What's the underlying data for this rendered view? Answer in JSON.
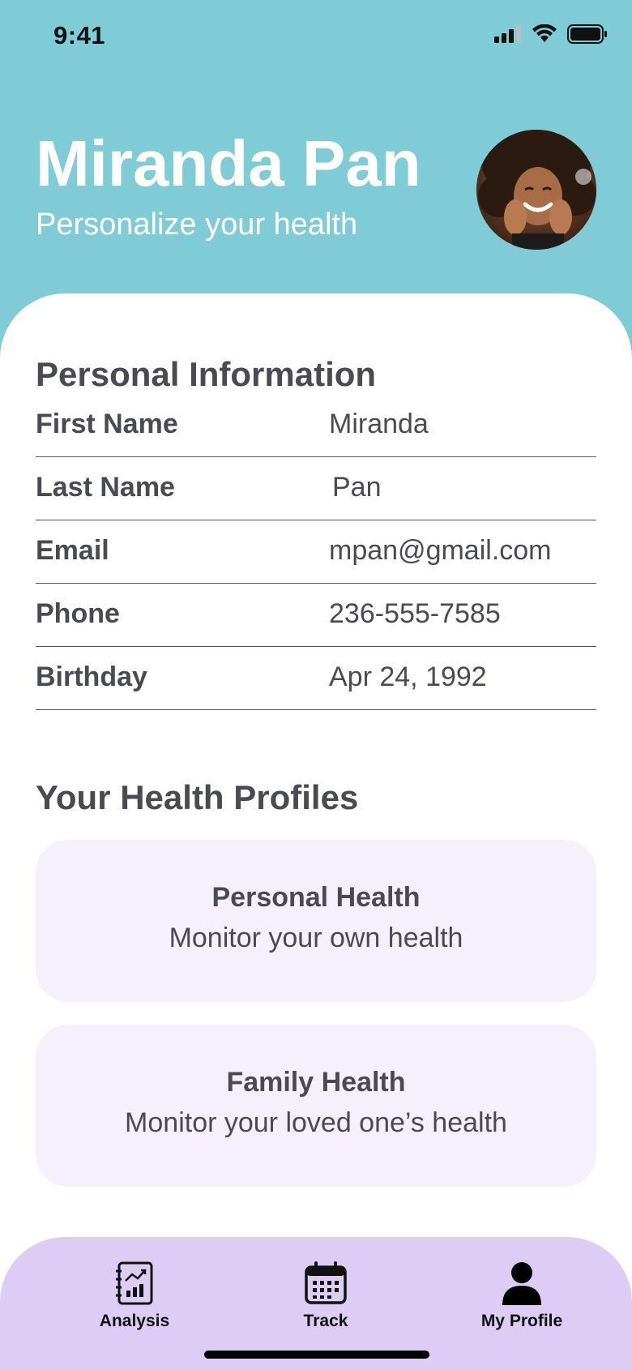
{
  "status": {
    "time": "9:41"
  },
  "header": {
    "name": "Miranda Pan",
    "subtitle": "Personalize your health"
  },
  "personal_info": {
    "title": "Personal Information",
    "rows": [
      {
        "label": "First Name",
        "value": "Miranda"
      },
      {
        "label": "Last Name",
        "value": "Pan"
      },
      {
        "label": "Email",
        "value": "mpan@gmail.com"
      },
      {
        "label": "Phone",
        "value": "236-555-7585"
      },
      {
        "label": "Birthday",
        "value": "Apr 24, 1992"
      }
    ]
  },
  "health_profiles": {
    "title": "Your Health Profiles",
    "cards": [
      {
        "title": "Personal Health",
        "subtitle": "Monitor your own health"
      },
      {
        "title": "Family Health",
        "subtitle": "Monitor your loved one’s health"
      }
    ]
  },
  "tabbar": {
    "tabs": [
      {
        "label": "Analysis",
        "icon": "analysis-notebook-icon"
      },
      {
        "label": "Track",
        "icon": "calendar-icon"
      },
      {
        "label": "My Profile",
        "icon": "person-icon"
      }
    ]
  },
  "colors": {
    "header_bg": "#7fccd7",
    "card_bg": "#f6f0fd",
    "tabbar_bg": "#ddcdf4",
    "text": "#4a4a52"
  }
}
